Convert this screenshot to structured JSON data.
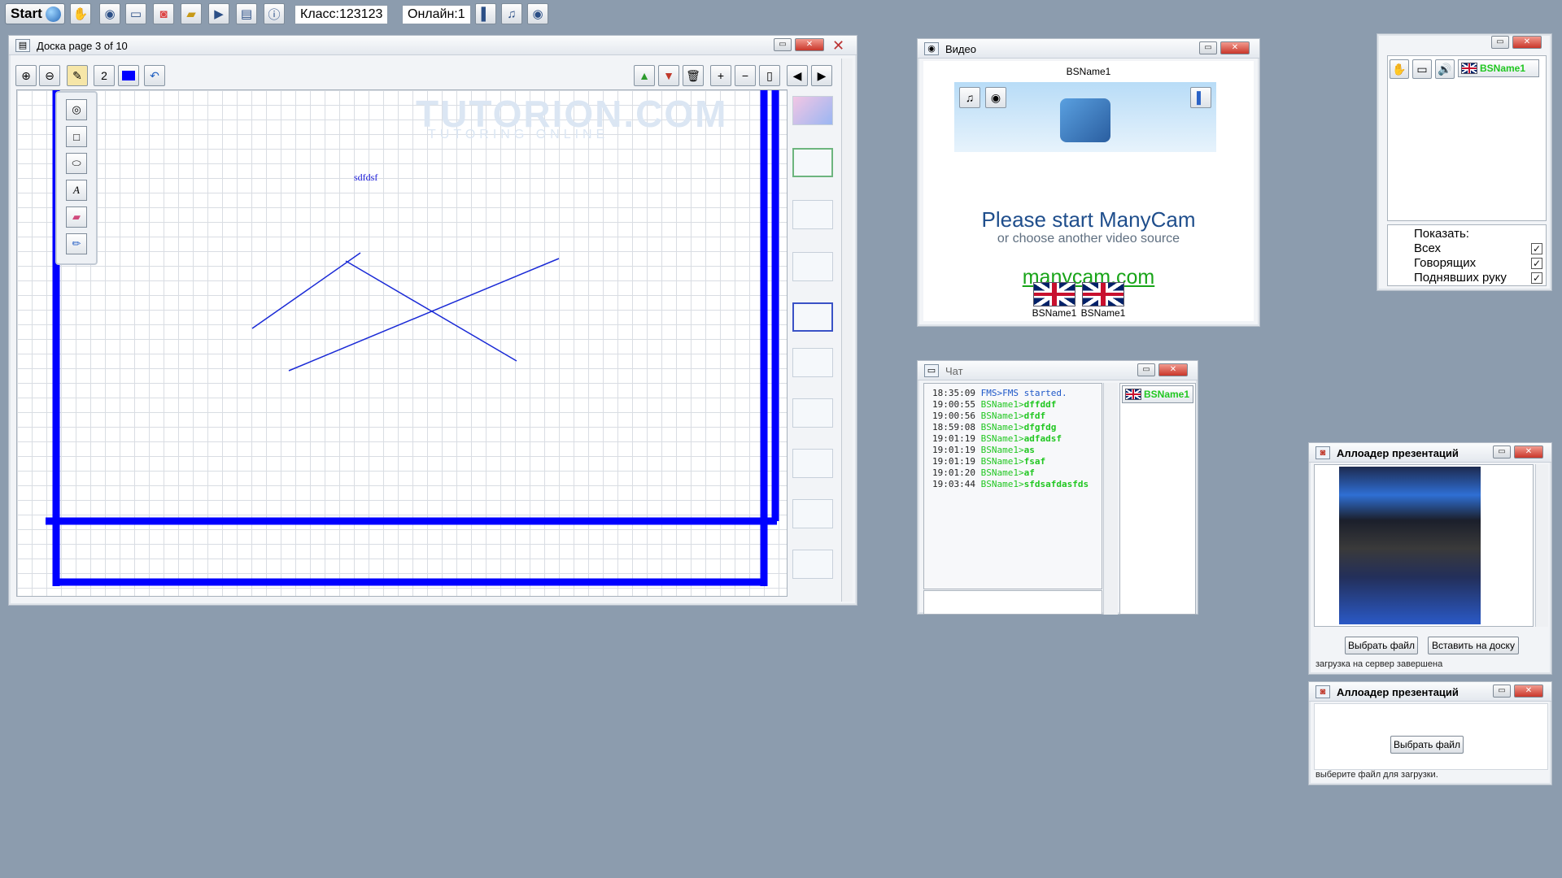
{
  "topbar": {
    "start_label": "Start",
    "class_label": "Класс:123123",
    "online_label": "Онлайн:1",
    "icons": [
      "hand-icon",
      "webcam-icon",
      "chat-icon",
      "media-icon",
      "folder-icon",
      "play-icon",
      "board-icon",
      "info-icon",
      "bar-icon",
      "music-icon",
      "camera-icon"
    ]
  },
  "board": {
    "title": "Доска  page 3 of 10",
    "pen_size": "2",
    "pen_color": "#0000ff",
    "canvas_text": "sdfdsf",
    "watermark_title": "TUTORION.COM",
    "watermark_sub": "TUTORING ONLINE"
  },
  "video": {
    "title": "Видео",
    "user_name": "BSName1",
    "headline": "Please start ManyCam",
    "subline": "or choose another video source",
    "link": "manycam.com",
    "users": [
      "BSName1",
      "BSName1"
    ]
  },
  "chat": {
    "title": "Чат",
    "user_name": "BSName1",
    "messages": [
      {
        "time": "18:35:09",
        "from": "FMS",
        "text": "FMS started.",
        "system": true
      },
      {
        "time": "19:00:55",
        "from": "BSName1",
        "text": "dffddf"
      },
      {
        "time": "19:00:56",
        "from": "BSName1",
        "text": "dfdf"
      },
      {
        "time": "18:59:08",
        "from": "BSName1",
        "text": "dfgfdg"
      },
      {
        "time": "19:01:19",
        "from": "BSName1",
        "text": "adfadsf"
      },
      {
        "time": "19:01:19",
        "from": "BSName1",
        "text": "as"
      },
      {
        "time": "19:01:19",
        "from": "BSName1",
        "text": "fsaf"
      },
      {
        "time": "19:01:20",
        "from": "BSName1",
        "text": "af"
      },
      {
        "time": "19:03:44",
        "from": "BSName1",
        "text": "sfdsafdasfds"
      }
    ]
  },
  "users_panel": {
    "user_name": "BSName1",
    "show_label": "Показать:",
    "options": [
      {
        "label": "Всех",
        "checked": true
      },
      {
        "label": "Говорящих",
        "checked": true
      },
      {
        "label": "Поднявших руку",
        "checked": true
      }
    ]
  },
  "uploader1": {
    "title": "Аллоадер презентаций",
    "choose_label": "Выбрать файл",
    "insert_label": "Вставить на доску",
    "status": "загрузка на сервер завершена"
  },
  "uploader2": {
    "title": "Аллоадер презентаций",
    "choose_label": "Выбрать файл",
    "status": "выберите файл для загрузки."
  }
}
